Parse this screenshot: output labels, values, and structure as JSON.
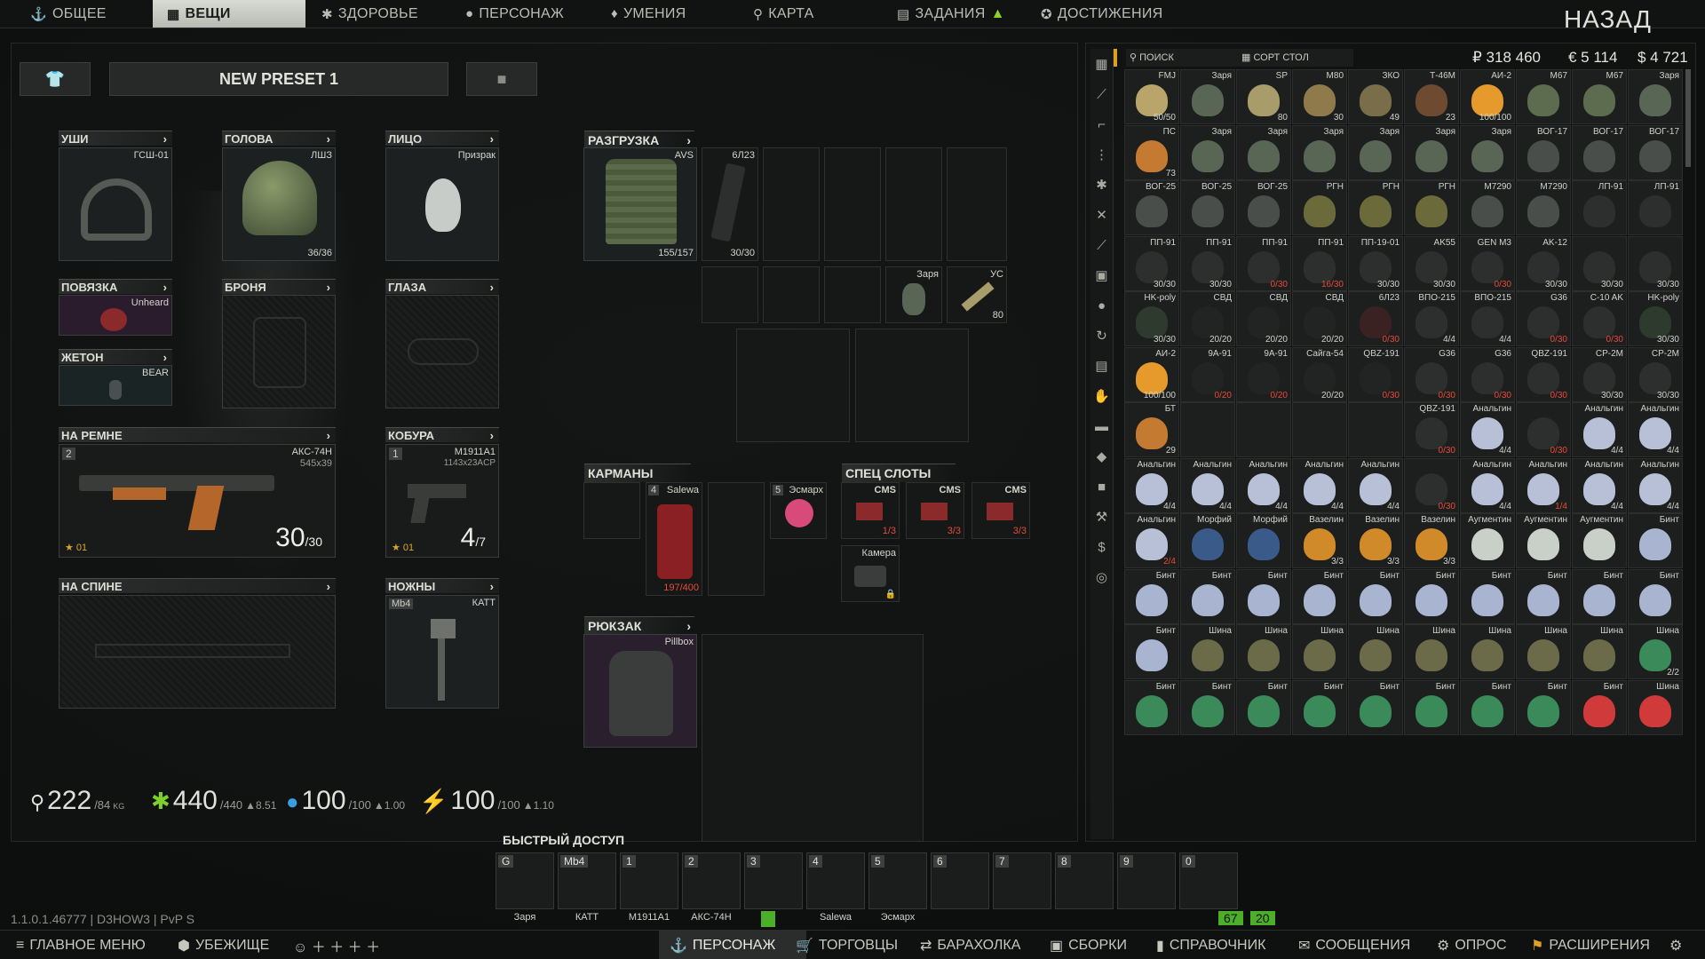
{
  "nav": {
    "tabs": [
      "ОБЩЕЕ",
      "ВЕЩИ",
      "ЗДОРОВЬЕ",
      "ПЕРСОНАЖ",
      "УМЕНИЯ",
      "КАРТА",
      "ЗАДАНИЯ",
      "ДОСТИЖЕНИЯ"
    ],
    "back": "НАЗАД"
  },
  "preset": {
    "name": "NEW PRESET 1"
  },
  "slots": {
    "ears": {
      "label": "УШИ",
      "item": "ГСШ-01"
    },
    "head": {
      "label": "ГОЛОВА",
      "item": "ЛШЗ",
      "count": "36/36"
    },
    "face": {
      "label": "ЛИЦО",
      "item": "Призрак"
    },
    "armband": {
      "label": "ПОВЯЗКА",
      "item": "Unheard"
    },
    "armor": {
      "label": "БРОНЯ"
    },
    "eyes": {
      "label": "ГЛАЗА"
    },
    "dogtag": {
      "label": "ЖЕТОН",
      "item": "BEAR"
    },
    "belt": {
      "label": "НА РЕМНЕ",
      "item": "АКС-74Н",
      "caliber": "545x39",
      "key": "2",
      "ammo": "30",
      "ammo_max": "/30",
      "tag": "01"
    },
    "holster": {
      "label": "КОБУРА",
      "item": "M1911A1",
      "caliber": "1143x23ACP",
      "key": "1",
      "ammo": "4",
      "ammo_max": "/7",
      "tag": "01"
    },
    "back": {
      "label": "НА СПИНЕ"
    },
    "knife": {
      "label": "НОЖНЫ",
      "item": "КАТТ",
      "key": "Mb4"
    }
  },
  "rig": {
    "label": "РАЗГРУЗКА",
    "item": "AVS",
    "count": "155/157",
    "mag": "6Л23",
    "mag_count": "30/30",
    "gren": "Заря",
    "ammo": "УС",
    "ammo_count": "80"
  },
  "pockets": {
    "label": "КАРМАНЫ",
    "salewa": "Salewa",
    "salewa_key": "4",
    "salewa_count": "197/400",
    "esmarch": "Эсмарх",
    "esmarch_key": "5"
  },
  "special": {
    "label": "СПЕЦ СЛОТЫ",
    "cms": "CMS",
    "c1": "1/3",
    "c2": "3/3",
    "c3": "3/3",
    "camera": "Камера"
  },
  "backpack": {
    "label": "РЮКЗАК",
    "item": "Pillbox"
  },
  "stats": {
    "weight": "222",
    "weight_max": "/84",
    "weight_unit": "KG",
    "energy": "440",
    "energy_max": "/440",
    "energy_rate": "▲8.51",
    "hydration": "100",
    "hydration_max": "/100",
    "hydration_rate": "▲1.00",
    "stamina": "100",
    "stamina_max": "/100",
    "stamina_rate": "▲1.10"
  },
  "quick": {
    "title": "БЫСТРЫЙ ДОСТУП",
    "slots": [
      {
        "k": "G",
        "l": "Заря"
      },
      {
        "k": "Mb4",
        "l": "КАТТ"
      },
      {
        "k": "1",
        "l": "M1911A1"
      },
      {
        "k": "2",
        "l": "АКС-74Н"
      },
      {
        "k": "3",
        "l": ""
      },
      {
        "k": "4",
        "l": "Salewa"
      },
      {
        "k": "5",
        "l": "Эсмарх"
      },
      {
        "k": "6",
        "l": ""
      },
      {
        "k": "7",
        "l": ""
      },
      {
        "k": "8",
        "l": ""
      },
      {
        "k": "9",
        "l": ""
      },
      {
        "k": "0",
        "l": ""
      }
    ],
    "fps": "67",
    "ping": "20"
  },
  "stash": {
    "search": "ПОИСК",
    "sort": "СОРТ СТОЛ",
    "rub": "₽ 318 460",
    "eur": "€ 5 114",
    "usd": "$ 4 721",
    "rows": [
      [
        [
          "FMJ",
          "50/50",
          "#b9a46a"
        ],
        [
          "Заря",
          "",
          "#5a6655"
        ],
        [
          "SP",
          "80",
          "#a89c6a"
        ],
        [
          "M80",
          "30",
          "#8e7a4a"
        ],
        [
          "ЗКО",
          "49",
          "#7a6d4a"
        ],
        [
          "Т-46М",
          "23",
          "#6d4a30"
        ],
        [
          "АИ-2",
          "100/100",
          "#e59a2b"
        ],
        [
          "M67",
          "",
          "#5d6b4e"
        ],
        [
          "M67",
          "",
          "#5d6b4e"
        ],
        [
          "Заря",
          "",
          "#5a6655"
        ]
      ],
      [
        [
          "ПС",
          "73",
          "#c47a30"
        ],
        [
          "Заря",
          "",
          "#5a6655"
        ],
        [
          "Заря",
          "",
          "#5a6655"
        ],
        [
          "Заря",
          "",
          "#5a6655"
        ],
        [
          "Заря",
          "",
          "#5a6655"
        ],
        [
          "Заря",
          "",
          "#5a6655"
        ],
        [
          "Заря",
          "",
          "#5a6655"
        ],
        [
          "ВОГ-17",
          "",
          "#4a4e4a"
        ],
        [
          "ВОГ-17",
          "",
          "#4a4e4a"
        ],
        [
          "ВОГ-17",
          "",
          "#4a4e4a"
        ]
      ],
      [
        [
          "ВОГ-25",
          "",
          "#4a4e4a"
        ],
        [
          "ВОГ-25",
          "",
          "#4a4e4a"
        ],
        [
          "ВОГ-25",
          "",
          "#4a4e4a"
        ],
        [
          "РГН",
          "",
          "#6b6a3a"
        ],
        [
          "РГН",
          "",
          "#6b6a3a"
        ],
        [
          "РГН",
          "",
          "#6b6a3a"
        ],
        [
          "M7290",
          "",
          "#4a4e4a"
        ],
        [
          "M7290",
          "",
          "#4a4e4a"
        ],
        [
          "ЛП-91",
          "",
          "#2c2f2e"
        ],
        [
          "ЛП-91",
          "",
          "#2c2f2e"
        ]
      ],
      [
        [
          "ПП-91",
          "30/30",
          "#2c2f2e"
        ],
        [
          "ПП-91",
          "30/30",
          "#2c2f2e"
        ],
        [
          "ПП-91",
          "0/30",
          "#2c2f2e"
        ],
        [
          "ПП-91",
          "16/30",
          "#2c2f2e"
        ],
        [
          "ПП-19-01",
          "30/30",
          "#2c2f2e"
        ],
        [
          "AK55",
          "30/30",
          "#2c2f2e"
        ],
        [
          "GEN M3",
          "0/30",
          "#2c2f2e"
        ],
        [
          "AK-12",
          "30/30",
          "#2c2f2e"
        ],
        [
          "",
          "30/30",
          "#2c2f2e"
        ],
        [
          "",
          "30/30",
          "#2c2f2e"
        ]
      ],
      [
        [
          "HK-poly",
          "30/30",
          "#2e3a2e"
        ],
        [
          "СВД",
          "20/20",
          "#222423"
        ],
        [
          "СВД",
          "20/20",
          "#222423"
        ],
        [
          "СВД",
          "20/20",
          "#222423"
        ],
        [
          "6Л23",
          "0/30",
          "#3a2222"
        ],
        [
          "ВПО-215",
          "4/4",
          "#2c2f2e"
        ],
        [
          "ВПО-215",
          "4/4",
          "#2c2f2e"
        ],
        [
          "G36",
          "0/30",
          "#2c2f2e"
        ],
        [
          "C-10 AK",
          "0/30",
          "#2c2f2e"
        ],
        [
          "HK-poly",
          "30/30",
          "#2e3a2e"
        ]
      ],
      [
        [
          "АИ-2",
          "100/100",
          "#e59a2b"
        ],
        [
          "9А-91",
          "0/20",
          "#222423"
        ],
        [
          "9А-91",
          "0/20",
          "#222423"
        ],
        [
          "Сайга-54",
          "20/20",
          "#222423"
        ],
        [
          "QBZ-191",
          "0/30",
          "#222423"
        ],
        [
          "G36",
          "0/30",
          "#2c2f2e"
        ],
        [
          "G36",
          "0/30",
          "#2c2f2e"
        ],
        [
          "QBZ-191",
          "0/30",
          "#2c2f2e"
        ],
        [
          "CP-2M",
          "30/30",
          "#2c2f2e"
        ],
        [
          "CP-2M",
          "30/30",
          "#2c2f2e"
        ]
      ],
      [
        [
          "БТ",
          "29",
          "#c47a30"
        ],
        [
          "",
          "",
          "#1c1f1e"
        ],
        [
          "",
          "",
          "#1c1f1e"
        ],
        [
          "",
          "",
          "#1c1f1e"
        ],
        [
          "",
          "",
          "#1c1f1e"
        ],
        [
          "QBZ-191",
          "0/30",
          "#2c2f2e"
        ],
        [
          "Анальгин",
          "4/4",
          "#b8c0d8"
        ],
        [
          "",
          "0/30",
          "#2c2f2e"
        ],
        [
          "Анальгин",
          "4/4",
          "#b8c0d8"
        ],
        [
          "Анальгин",
          "4/4",
          "#b8c0d8"
        ]
      ],
      [
        [
          "Анальгин",
          "4/4",
          "#b8c0d8"
        ],
        [
          "Анальгин",
          "4/4",
          "#b8c0d8"
        ],
        [
          "Анальгин",
          "4/4",
          "#b8c0d8"
        ],
        [
          "Анальгин",
          "4/4",
          "#b8c0d8"
        ],
        [
          "Анальгин",
          "4/4",
          "#b8c0d8"
        ],
        [
          "",
          "0/30",
          "#2c2f2e"
        ],
        [
          "Анальгин",
          "4/4",
          "#b8c0d8"
        ],
        [
          "Анальгин",
          "1/4",
          "#b8c0d8"
        ],
        [
          "Анальгин",
          "4/4",
          "#b8c0d8"
        ],
        [
          "Анальгин",
          "4/4",
          "#b8c0d8"
        ]
      ],
      [
        [
          "Анальгин",
          "2/4",
          "#b8c0d8"
        ],
        [
          "Морфий",
          "",
          "#3a5a8a"
        ],
        [
          "Морфий",
          "",
          "#3a5a8a"
        ],
        [
          "Вазелин",
          "3/3",
          "#d08a2a"
        ],
        [
          "Вазелин",
          "3/3",
          "#d08a2a"
        ],
        [
          "Вазелин",
          "3/3",
          "#d08a2a"
        ],
        [
          "Аугментин",
          "",
          "#c9d0c8"
        ],
        [
          "Аугментин",
          "",
          "#c9d0c8"
        ],
        [
          "Аугментин",
          "",
          "#c9d0c8"
        ],
        [
          "Бинт",
          "",
          "#a8b4d0"
        ]
      ],
      [
        [
          "Бинт",
          "",
          "#a8b4d0"
        ],
        [
          "Бинт",
          "",
          "#a8b4d0"
        ],
        [
          "Бинт",
          "",
          "#a8b4d0"
        ],
        [
          "Бинт",
          "",
          "#a8b4d0"
        ],
        [
          "Бинт",
          "",
          "#a8b4d0"
        ],
        [
          "Бинт",
          "",
          "#a8b4d0"
        ],
        [
          "Бинт",
          "",
          "#a8b4d0"
        ],
        [
          "Бинт",
          "",
          "#a8b4d0"
        ],
        [
          "Бинт",
          "",
          "#a8b4d0"
        ],
        [
          "Бинт",
          "",
          "#a8b4d0"
        ]
      ],
      [
        [
          "Бинт",
          "",
          "#a8b4d0"
        ],
        [
          "Шина",
          "",
          "#6b6b4a"
        ],
        [
          "Шина",
          "",
          "#6b6b4a"
        ],
        [
          "Шина",
          "",
          "#6b6b4a"
        ],
        [
          "Шина",
          "",
          "#6b6b4a"
        ],
        [
          "Шина",
          "",
          "#6b6b4a"
        ],
        [
          "Шина",
          "",
          "#6b6b4a"
        ],
        [
          "Шина",
          "",
          "#6b6b4a"
        ],
        [
          "Шина",
          "",
          "#6b6b4a"
        ],
        [
          "Шина",
          "2/2",
          "#3a8a5a"
        ]
      ],
      [
        [
          "Бинт",
          "",
          "#3a8a5a"
        ],
        [
          "Бинт",
          "",
          "#3a8a5a"
        ],
        [
          "Бинт",
          "",
          "#3a8a5a"
        ],
        [
          "Бинт",
          "",
          "#3a8a5a"
        ],
        [
          "Бинт",
          "",
          "#3a8a5a"
        ],
        [
          "Бинт",
          "",
          "#3a8a5a"
        ],
        [
          "Бинт",
          "",
          "#3a8a5a"
        ],
        [
          "Бинт",
          "",
          "#3a8a5a"
        ],
        [
          "Бинт",
          "",
          "#d03a3a"
        ],
        [
          "Шина",
          "",
          "#d03a3a"
        ]
      ]
    ]
  },
  "version": "1.1.0.1.46777 | D3HOW3 | PvP S",
  "bottom": [
    "ГЛАВНОЕ МЕНЮ",
    "УБЕЖИЩЕ",
    "ПЕРСОНАЖ",
    "ТОРГОВЦЫ",
    "БАРАХОЛКА",
    "СБОРКИ",
    "СПРАВОЧНИК",
    "СООБЩЕНИЯ",
    "ОПРОС",
    "РАСШИРЕНИЯ"
  ],
  "colors": {
    "accent": "#d7dad2",
    "energy": "#7bd12a",
    "water": "#3a9fe0",
    "health_red": "#e03a3a",
    "fps_green": "#4caf2a"
  }
}
